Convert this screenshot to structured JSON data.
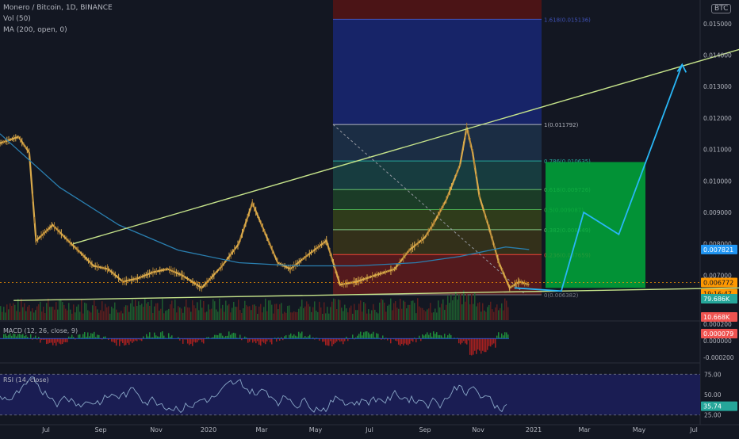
{
  "header": {
    "title": "Monero / Bitcoin, 1D, BINANCE",
    "vol": "Vol (50)",
    "ma": "MA (200, open, 0)",
    "currency_badge": "BTC"
  },
  "chart_data": [
    {
      "type": "candlestick",
      "symbol": "XMR/BTC",
      "title": "Monero / Bitcoin, 1D, BINANCE",
      "ylim": [
        0.00555,
        0.01575
      ],
      "y_ticks": [
        "0.015000",
        "0.014000",
        "0.013000",
        "0.012000",
        "0.011000",
        "0.010000",
        "0.009000",
        "0.008000",
        "0.007000"
      ],
      "x_ticks": [
        "Jul",
        "Sep",
        "Nov",
        "2020",
        "Mar",
        "May",
        "Jul",
        "Sep",
        "Nov",
        "2021",
        "Mar",
        "May",
        "Jul"
      ],
      "price_path": [
        [
          "2019-06-01",
          0.0112
        ],
        [
          "2019-06-20",
          0.0114
        ],
        [
          "2019-07-01",
          0.0109
        ],
        [
          "2019-07-08",
          0.0081
        ],
        [
          "2019-07-25",
          0.0086
        ],
        [
          "2019-08-10",
          0.0081
        ],
        [
          "2019-08-20",
          0.0078
        ],
        [
          "2019-09-05",
          0.0073
        ],
        [
          "2019-09-20",
          0.0072
        ],
        [
          "2019-10-05",
          0.0068
        ],
        [
          "2019-10-20",
          0.0069
        ],
        [
          "2019-11-05",
          0.0071
        ],
        [
          "2019-11-20",
          0.0072
        ],
        [
          "2019-12-05",
          0.007
        ],
        [
          "2019-12-25",
          0.0066
        ],
        [
          "2020-01-15",
          0.0073
        ],
        [
          "2020-02-01",
          0.008
        ],
        [
          "2020-02-15",
          0.0093
        ],
        [
          "2020-03-01",
          0.0082
        ],
        [
          "2020-03-12",
          0.0074
        ],
        [
          "2020-03-25",
          0.0072
        ],
        [
          "2020-04-10",
          0.0076
        ],
        [
          "2020-05-01",
          0.0081
        ],
        [
          "2020-05-15",
          0.0067
        ],
        [
          "2020-06-01",
          0.0068
        ],
        [
          "2020-06-20",
          0.007
        ],
        [
          "2020-07-10",
          0.0072
        ],
        [
          "2020-07-25",
          0.0078
        ],
        [
          "2020-08-10",
          0.0082
        ],
        [
          "2020-08-20",
          0.0087
        ],
        [
          "2020-09-01",
          0.0094
        ],
        [
          "2020-09-15",
          0.0105
        ],
        [
          "2020-09-22",
          0.0117
        ],
        [
          "2020-09-28",
          0.0109
        ],
        [
          "2020-10-05",
          0.0095
        ],
        [
          "2020-10-15",
          0.0085
        ],
        [
          "2020-10-25",
          0.0074
        ],
        [
          "2020-11-05",
          0.0066
        ],
        [
          "2020-11-15",
          0.0068
        ],
        [
          "2020-11-25",
          0.0067
        ]
      ],
      "ma200_path": [
        [
          "2019-06-01",
          0.0115
        ],
        [
          "2019-08-01",
          0.0098
        ],
        [
          "2019-10-01",
          0.0086
        ],
        [
          "2019-12-01",
          0.0078
        ],
        [
          "2020-02-01",
          0.0074
        ],
        [
          "2020-04-01",
          0.0073
        ],
        [
          "2020-06-01",
          0.0073
        ],
        [
          "2020-08-01",
          0.0074
        ],
        [
          "2020-09-15",
          0.0076
        ],
        [
          "2020-11-01",
          0.0079
        ],
        [
          "2020-11-25",
          0.00782
        ]
      ],
      "fib_levels": [
        {
          "ratio": "0",
          "price": "0.006382",
          "label": "0(0.006382)"
        },
        {
          "ratio": "0.236",
          "price": "0.007659",
          "label": "0.236(0.007659)"
        },
        {
          "ratio": "0.382",
          "price": "0.008449",
          "label": "0.382(0.008449)"
        },
        {
          "ratio": "0.5",
          "price": "0.009087",
          "label": "0.5(0.009087)"
        },
        {
          "ratio": "0.618",
          "price": "0.009726",
          "label": "0.618(0.009726)"
        },
        {
          "ratio": "0.786",
          "price": "0.010635",
          "label": "0.786(0.010635)"
        },
        {
          "ratio": "1",
          "price": "0.011792",
          "label": "1(0.011792)"
        },
        {
          "ratio": "1.618",
          "price": "0.015136",
          "label": "1.618(0.015136)"
        }
      ],
      "trendline_upper": [
        [
          "2019-08-15",
          0.008
        ],
        [
          "2021-07-01",
          0.0142
        ]
      ],
      "trendline_lower": [
        [
          "2019-06-15",
          0.0062
        ],
        [
          "2021-07-01",
          0.0066
        ]
      ],
      "projection_path": [
        [
          "2020-11-10",
          0.0066
        ],
        [
          "2020-12-28",
          0.0065
        ],
        [
          "2021-01-20",
          0.009
        ],
        [
          "2021-02-25",
          0.0083
        ],
        [
          "2021-05-01",
          0.0137
        ]
      ],
      "target_box": {
        "price_top": 0.0106,
        "price_bottom": 0.0066
      },
      "price_labels": [
        {
          "name": "ma200",
          "text": "0.007821",
          "price": 0.007821,
          "color": "#2196f3"
        },
        {
          "name": "last",
          "text": "0.006772",
          "price": 0.006772,
          "color": "#ff9800"
        },
        {
          "name": "countdown",
          "text": "19:16:47",
          "price": 0.00662,
          "color": "#ff9800"
        }
      ],
      "volume_labels": [
        {
          "name": "ma",
          "text": "79.686K",
          "color": "#26a69a"
        },
        {
          "name": "vol",
          "text": "10.668K",
          "color": "#ef5350"
        }
      ]
    },
    {
      "type": "histogram",
      "title": "MACD (12, 26, close, 9)",
      "ylim": [
        -0.00025,
        0.00015
      ],
      "y_ticks": [
        "0.000200",
        "0.000000",
        "-0.000200"
      ],
      "last_label": "0.000079"
    },
    {
      "type": "line",
      "title": "RSI (14, close)",
      "ylim": [
        15,
        85
      ],
      "y_ticks": [
        "75.00",
        "50.00",
        "25.00"
      ],
      "last_label": "35.74"
    }
  ],
  "colors": {
    "background": "#131722",
    "candle_up": "#d9a94a",
    "candle_down": "#a67930",
    "ma200": "#2a7fb0",
    "trendline": "#c6e48b",
    "projection": "#29b6f6",
    "target_green": "#00a83a",
    "fib_blue": "#1a237e",
    "fib_red": "#5a1414",
    "rsi_band": "#1c1e5c"
  }
}
